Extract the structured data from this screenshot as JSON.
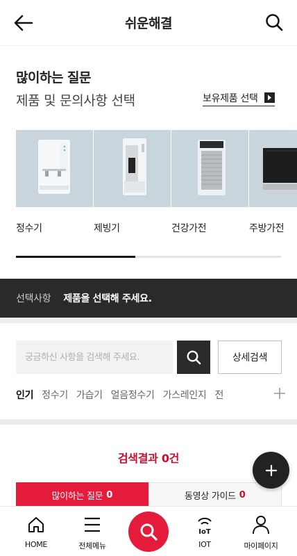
{
  "header": {
    "title": "쉬운해결",
    "back_icon": "arrow-left-icon",
    "search_icon": "search-icon"
  },
  "faq": {
    "title": "많이하는 질문",
    "subtitle": "제품 및 문의사항 선택",
    "owned_label": "보유제품 선택",
    "owned_icon": "chevron-right-icon"
  },
  "categories": [
    {
      "name": "정수기",
      "icon": "water-purifier-image"
    },
    {
      "name": "제빙기",
      "icon": "ice-maker-image"
    },
    {
      "name": "건강가전",
      "icon": "air-purifier-image"
    },
    {
      "name": "주방가전",
      "icon": "oven-image"
    }
  ],
  "carousel_progress": 0.45,
  "selection": {
    "label": "선택사항",
    "message": "제품을 선택해 주세요."
  },
  "search": {
    "placeholder": "궁금하신 사항을 검색해 주세요.",
    "value": "",
    "detail_label": "상세검색"
  },
  "keywords": [
    "인기",
    "정수기",
    "가습기",
    "얼음정수기",
    "가스레인지",
    "전"
  ],
  "active_keyword": "인기",
  "result": {
    "text": "검색결과 0건"
  },
  "tabs": [
    {
      "label": "많이하는 질문",
      "count": "0",
      "active": true
    },
    {
      "label": "동영상 가이드",
      "count": "0",
      "active": false
    }
  ],
  "bottom_nav": {
    "home": "HOME",
    "menu": "전체메뉴",
    "iot": "IOT",
    "mypage": "마이페이지"
  },
  "colors": {
    "accent": "#e41b3a",
    "dark": "#2a2a2a",
    "thumb_bg": "#c8d5dd"
  }
}
